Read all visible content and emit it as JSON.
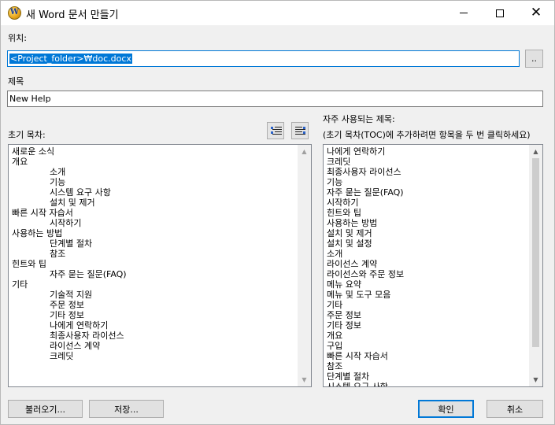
{
  "window": {
    "title": "새 Word 문서 만들기",
    "app_icon_letter": "W"
  },
  "location": {
    "label": "위치:",
    "value": "<Project_folder>₩doc.docx",
    "browse_label": ".."
  },
  "title_field": {
    "label": "제목",
    "value": "New Help"
  },
  "toc": {
    "label": "초기 목차:",
    "items": [
      {
        "text": "새로운 소식",
        "level": 1
      },
      {
        "text": "개요",
        "level": 1
      },
      {
        "text": "소개",
        "level": 2
      },
      {
        "text": "기능",
        "level": 2
      },
      {
        "text": "시스템 요구 사항",
        "level": 2
      },
      {
        "text": "설치 및 제거",
        "level": 2
      },
      {
        "text": "빠른 시작 자습서",
        "level": 1
      },
      {
        "text": "시작하기",
        "level": 2
      },
      {
        "text": "사용하는 방법",
        "level": 1
      },
      {
        "text": "단계별 절차",
        "level": 2
      },
      {
        "text": "참조",
        "level": 2
      },
      {
        "text": "힌트와 팁",
        "level": 1
      },
      {
        "text": "자주 묻는 질문(FAQ)",
        "level": 2
      },
      {
        "text": "기타",
        "level": 1
      },
      {
        "text": "기술적 지원",
        "level": 2
      },
      {
        "text": "주문 정보",
        "level": 2
      },
      {
        "text": "기타 정보",
        "level": 2
      },
      {
        "text": "나에게 연락하기",
        "level": 2
      },
      {
        "text": "최종사용자 라이선스",
        "level": 2
      },
      {
        "text": "라이선스 계약",
        "level": 2
      },
      {
        "text": "크레딧",
        "level": 2
      }
    ]
  },
  "common": {
    "label": "자주 사용되는 제목:",
    "hint": "(초기 목차(TOC)에 추가하려면 항목을 두 번 클릭하세요)",
    "items": [
      "나에게 연락하기",
      "크레딧",
      "최종사용자 라이선스",
      "기능",
      "자주 묻는 질문(FAQ)",
      "시작하기",
      "힌트와 팁",
      "사용하는 방법",
      "설치 및 제거",
      "설치 및 설정",
      "소개",
      "라이선스 계약",
      "라이선스와 주문 정보",
      "메뉴 요약",
      "메뉴 및 도구 모음",
      "기타",
      "주문 정보",
      "기타 정보",
      "개요",
      "구입",
      "빠른 시작 자습서",
      "참조",
      "단계별 절차",
      "시스템 요구 사항"
    ]
  },
  "buttons": {
    "load": "불러오기...",
    "save": "저장...",
    "ok": "확인",
    "cancel": "취소"
  },
  "colors": {
    "accent": "#0078d7",
    "dialog_bg": "#f0f0f0"
  }
}
